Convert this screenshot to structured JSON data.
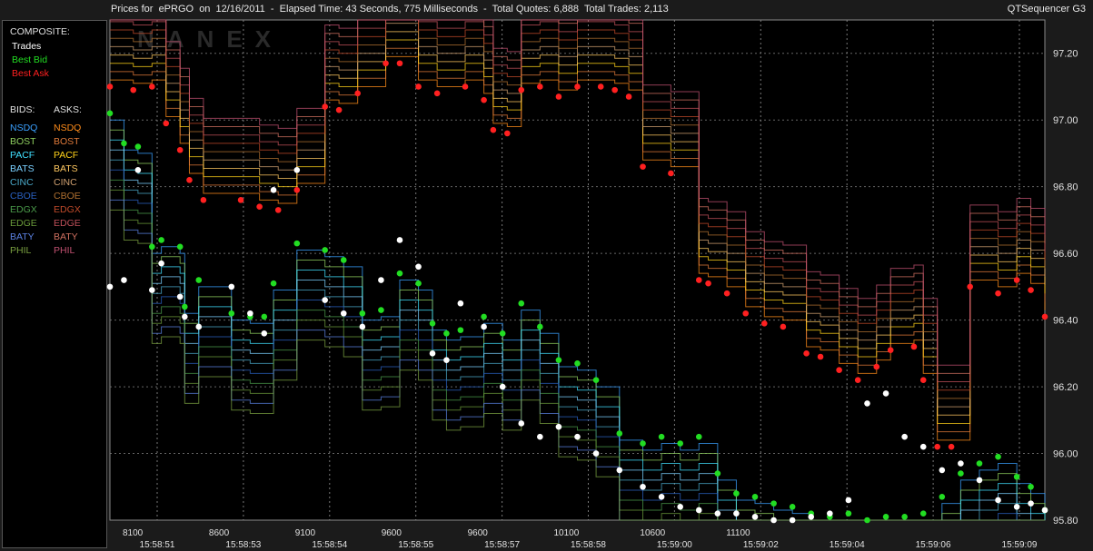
{
  "header": {
    "title": "Prices for  ePRGO  on  12/16/2011  -  Elapsed Time: 43 Seconds, 775 Milliseconds  -  Total Quotes: 6,888  Total Trades: 2,113",
    "product": "QTSequencer G3"
  },
  "legend": {
    "composite_label": "COMPOSITE:",
    "composite": [
      {
        "label": "Trades",
        "color": "#ffffff"
      },
      {
        "label": "Best Bid",
        "color": "#22dd22"
      },
      {
        "label": "Best Ask",
        "color": "#ff2020"
      }
    ],
    "bids_label": "BIDS:",
    "asks_label": "ASKS:",
    "exchanges": [
      {
        "bid": "NSDQ",
        "ask": "NSDQ",
        "bid_color": "#3aa0ff",
        "ask_color": "#ff8c1a"
      },
      {
        "bid": "BOST",
        "ask": "BOST",
        "bid_color": "#8fcf5f",
        "ask_color": "#e07a3a"
      },
      {
        "bid": "PACF",
        "ask": "PACF",
        "bid_color": "#40e0ff",
        "ask_color": "#ffd21a"
      },
      {
        "bid": "BATS",
        "ask": "BATS",
        "bid_color": "#7ad0ff",
        "ask_color": "#ffc860"
      },
      {
        "bid": "CINC",
        "ask": "CINC",
        "bid_color": "#4aa8c8",
        "ask_color": "#d0a070"
      },
      {
        "bid": "CBOE",
        "ask": "CBOE",
        "bid_color": "#2a60c0",
        "ask_color": "#b07030"
      },
      {
        "bid": "EDGX",
        "ask": "EDGX",
        "bid_color": "#4a9a4a",
        "ask_color": "#c04a2a"
      },
      {
        "bid": "EDGE",
        "ask": "EDGE",
        "bid_color": "#6a9a3a",
        "ask_color": "#c0505a"
      },
      {
        "bid": "BATY",
        "ask": "BATY",
        "bid_color": "#5a80e0",
        "ask_color": "#d07060"
      },
      {
        "bid": "PHIL",
        "ask": "PHIL",
        "bid_color": "#7aa040",
        "ask_color": "#c05070"
      }
    ]
  },
  "chart_data": {
    "type": "scatter",
    "ylim": [
      95.8,
      97.3
    ],
    "y_ticks": [
      "97.20",
      "97.00",
      "96.80",
      "96.60",
      "96.40",
      "96.20",
      "96.00",
      "95.80"
    ],
    "x_ticks": [
      {
        "seq": "8100",
        "time": "15:58:51"
      },
      {
        "seq": "8600",
        "time": "15:58:53"
      },
      {
        "seq": "9100",
        "time": "15:58:54"
      },
      {
        "seq": "9600",
        "time": "15:58:55"
      },
      {
        "seq": "9600",
        "time": "15:58:57"
      },
      {
        "seq": "10100",
        "time": "15:58:58"
      },
      {
        "seq": "10600",
        "time": "15:59:00"
      },
      {
        "seq": "11100",
        "time": "15:59:02"
      },
      {
        "seq": "",
        "time": "15:59:04"
      },
      {
        "seq": "",
        "time": "15:59:06"
      },
      {
        "seq": "",
        "time": "15:59:09"
      }
    ],
    "xlim": [
      0,
      1000
    ],
    "watermark": "NANEX",
    "series": [
      {
        "name": "Best Ask",
        "color": "#ff2020",
        "x": [
          0,
          25,
          45,
          60,
          75,
          85,
          100,
          140,
          160,
          180,
          200,
          230,
          245,
          265,
          295,
          310,
          330,
          350,
          380,
          400,
          410,
          425,
          440,
          460,
          480,
          500,
          525,
          540,
          555,
          570,
          600,
          630,
          640,
          660,
          680,
          700,
          720,
          745,
          760,
          780,
          800,
          820,
          835,
          860,
          870,
          885,
          900,
          920,
          950,
          970,
          985,
          1000
        ],
        "y": [
          97.1,
          97.09,
          97.1,
          96.99,
          96.91,
          96.82,
          96.76,
          96.76,
          96.74,
          96.73,
          96.79,
          97.04,
          97.03,
          97.08,
          97.17,
          97.17,
          97.1,
          97.08,
          97.1,
          97.06,
          96.97,
          96.96,
          97.09,
          97.1,
          97.07,
          97.1,
          97.1,
          97.09,
          97.07,
          96.86,
          96.84,
          96.52,
          96.51,
          96.48,
          96.42,
          96.39,
          96.38,
          96.3,
          96.29,
          96.25,
          96.22,
          96.26,
          96.31,
          96.32,
          96.22,
          96.02,
          96.02,
          96.5,
          96.48,
          96.52,
          96.49,
          96.41
        ]
      },
      {
        "name": "Best Bid",
        "color": "#22dd22",
        "x": [
          0,
          15,
          30,
          45,
          55,
          75,
          80,
          95,
          130,
          150,
          165,
          175,
          200,
          230,
          250,
          270,
          290,
          310,
          330,
          345,
          360,
          375,
          400,
          420,
          440,
          460,
          480,
          500,
          520,
          545,
          570,
          590,
          610,
          630,
          650,
          670,
          690,
          710,
          730,
          750,
          770,
          790,
          810,
          830,
          850,
          870,
          890,
          910,
          930,
          950,
          970,
          985,
          1000
        ],
        "y": [
          97.02,
          96.93,
          96.92,
          96.62,
          96.64,
          96.62,
          96.44,
          96.52,
          96.42,
          96.41,
          96.41,
          96.51,
          96.63,
          96.61,
          96.58,
          96.42,
          96.43,
          96.54,
          96.51,
          96.39,
          96.36,
          96.37,
          96.41,
          96.36,
          96.45,
          96.38,
          96.28,
          96.27,
          96.22,
          96.06,
          96.03,
          96.05,
          96.03,
          96.05,
          95.94,
          95.88,
          95.87,
          95.85,
          95.84,
          95.82,
          95.81,
          95.82,
          95.8,
          95.81,
          95.81,
          95.82,
          95.87,
          95.94,
          95.97,
          95.99,
          95.93,
          95.9,
          95.83
        ]
      },
      {
        "name": "Trades",
        "color": "#ffffff",
        "x": [
          0,
          15,
          30,
          45,
          55,
          75,
          80,
          95,
          130,
          150,
          165,
          175,
          200,
          230,
          250,
          270,
          290,
          310,
          330,
          345,
          360,
          375,
          400,
          420,
          440,
          460,
          480,
          500,
          520,
          545,
          570,
          590,
          610,
          630,
          650,
          670,
          690,
          710,
          730,
          750,
          770,
          790,
          810,
          830,
          850,
          870,
          890,
          910,
          930,
          950,
          970,
          985,
          1000
        ],
        "y": [
          96.5,
          96.52,
          96.85,
          96.49,
          96.57,
          96.47,
          96.41,
          96.38,
          96.5,
          96.42,
          96.36,
          96.79,
          96.85,
          96.46,
          96.42,
          96.38,
          96.52,
          96.64,
          96.56,
          96.3,
          96.28,
          96.45,
          96.38,
          96.2,
          96.09,
          96.05,
          96.08,
          96.05,
          96.0,
          95.95,
          95.9,
          95.87,
          95.84,
          95.83,
          95.82,
          95.82,
          95.81,
          95.8,
          95.8,
          95.81,
          95.82,
          95.86,
          96.15,
          96.18,
          96.05,
          96.02,
          95.95,
          95.97,
          95.92,
          95.86,
          95.84,
          95.85,
          95.83
        ]
      }
    ]
  }
}
